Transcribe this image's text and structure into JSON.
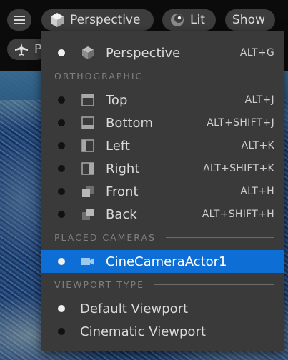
{
  "toolbar": {
    "menu_icon": "hamburger-icon",
    "perspective_label": "Perspective",
    "lit_label": "Lit",
    "show_label": "Show",
    "camera_speed_label": "P"
  },
  "menu": {
    "perspective": {
      "label": "Perspective",
      "shortcut": "ALT+G",
      "icon": "cube-icon",
      "selected_dot": true
    },
    "orthographic_header": "ORTHOGRAPHIC",
    "ortho_items": [
      {
        "label": "Top",
        "shortcut": "ALT+J",
        "icon": "view-top-icon"
      },
      {
        "label": "Bottom",
        "shortcut": "ALT+SHIFT+J",
        "icon": "view-bottom-icon"
      },
      {
        "label": "Left",
        "shortcut": "ALT+K",
        "icon": "view-left-icon"
      },
      {
        "label": "Right",
        "shortcut": "ALT+SHIFT+K",
        "icon": "view-right-icon"
      },
      {
        "label": "Front",
        "shortcut": "ALT+H",
        "icon": "view-front-icon"
      },
      {
        "label": "Back",
        "shortcut": "ALT+SHIFT+H",
        "icon": "view-back-icon"
      }
    ],
    "placed_cameras_header": "PLACED CAMERAS",
    "camera_item": {
      "label": "CineCameraActor1",
      "icon": "cine-camera-icon",
      "highlighted": true
    },
    "viewport_type_header": "VIEWPORT TYPE",
    "viewport_types": [
      {
        "label": "Default Viewport",
        "active": true
      },
      {
        "label": "Cinematic Viewport",
        "active": false
      }
    ]
  },
  "colors": {
    "menu_bg": "#3a3a3a",
    "highlight": "#0d6fd6",
    "pill_bg": "#3d3d3d",
    "section_text": "#7f7f7f"
  }
}
